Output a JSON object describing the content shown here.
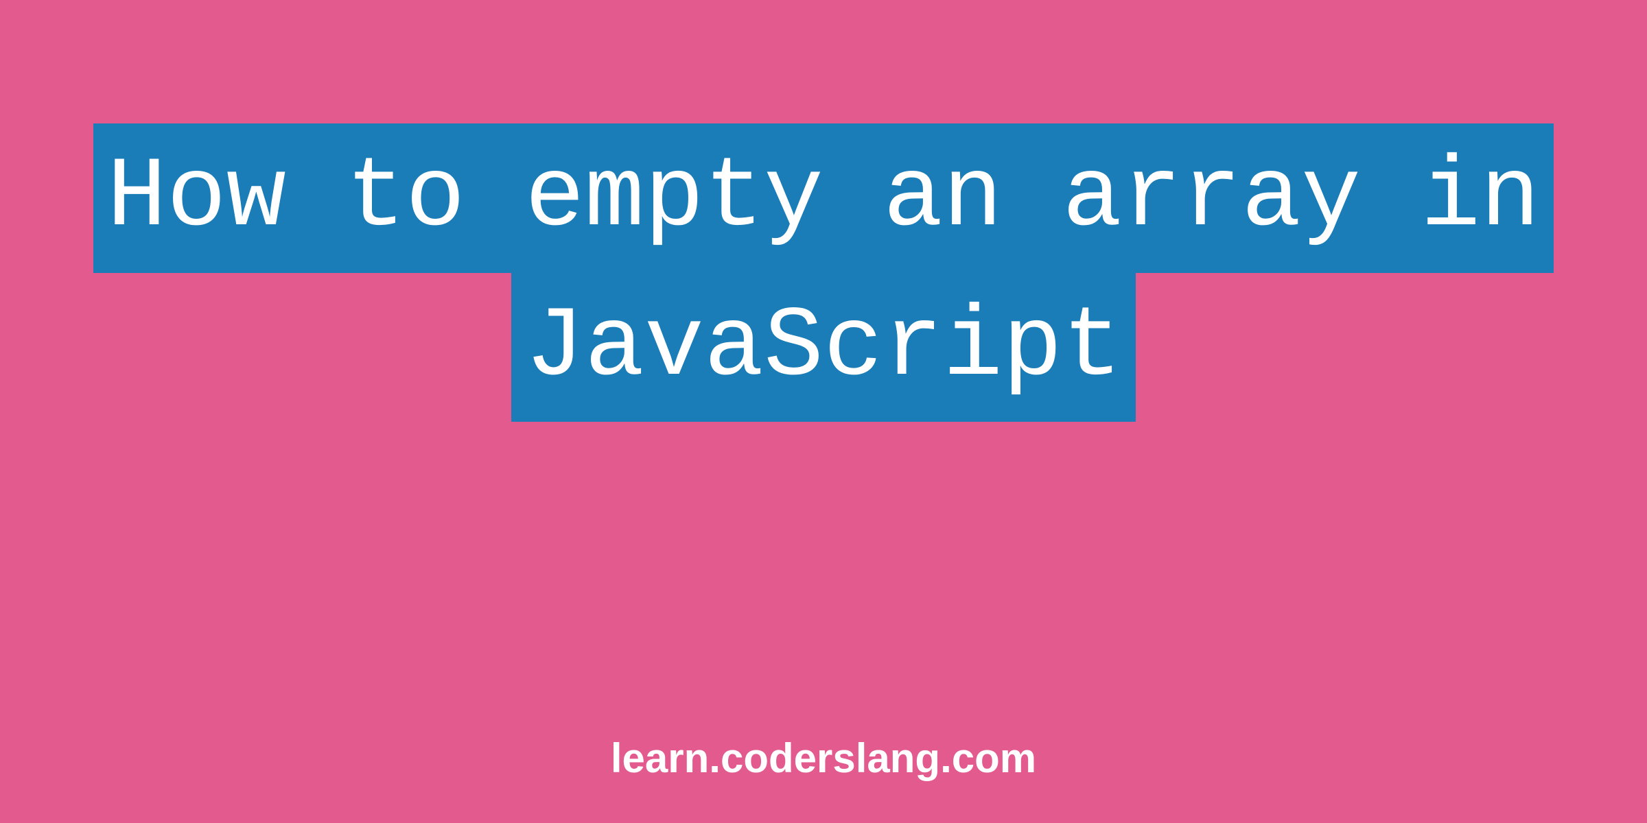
{
  "title": {
    "line1": "How to empty an array in",
    "line2": "JavaScript"
  },
  "footer": {
    "url": "learn.coderslang.com"
  },
  "colors": {
    "background": "#e25a8e",
    "highlight": "#1a7db8",
    "text": "#ffffff"
  }
}
